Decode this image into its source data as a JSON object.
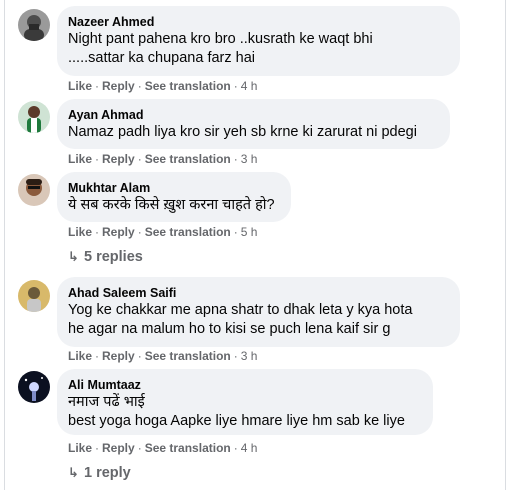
{
  "comments": [
    {
      "author": "Nazeer Ahmed",
      "text": "Night pant pahena kro bro ..kusrath ke waqt bhi\n.....sattar ka chupana farz hai",
      "actions": {
        "like": "Like",
        "reply": "Reply",
        "translate": "See translation",
        "time": "4 h"
      }
    },
    {
      "author": "Ayan Ahmad",
      "text": "Namaz padh liya kro sir yeh sb krne ki zarurat ni pdegi",
      "actions": {
        "like": "Like",
        "reply": "Reply",
        "translate": "See translation",
        "time": "3 h"
      }
    },
    {
      "author": "Mukhtar Alam",
      "text": "ये सब करके किसे ख़ुश करना चाहते हो?",
      "actions": {
        "like": "Like",
        "reply": "Reply",
        "translate": "See translation",
        "time": "5 h"
      },
      "replies_label": "5 replies"
    },
    {
      "author": "Ahad Saleem Saifi",
      "text": "Yog ke chakkar me apna shatr to dhak leta y kya hota\nhe agar na malum ho to kisi se puch lena kaif sir g",
      "actions": {
        "like": "Like",
        "reply": "Reply",
        "translate": "See translation",
        "time": "3 h"
      }
    },
    {
      "author": "Ali Mumtaaz",
      "text": "नमाज पढें भाई\nbest yoga hoga Aapke liye hmare liye hm sab ke liye",
      "actions": {
        "like": "Like",
        "reply": "Reply",
        "translate": "See translation",
        "time": "4 h"
      },
      "replies_label": "1 reply"
    }
  ],
  "separator": "·",
  "reply_arrow_icon": "reply-arrow-icon",
  "colors": {
    "bubble": "#f0f2f5",
    "meta": "#65676b",
    "text": "#050505"
  }
}
